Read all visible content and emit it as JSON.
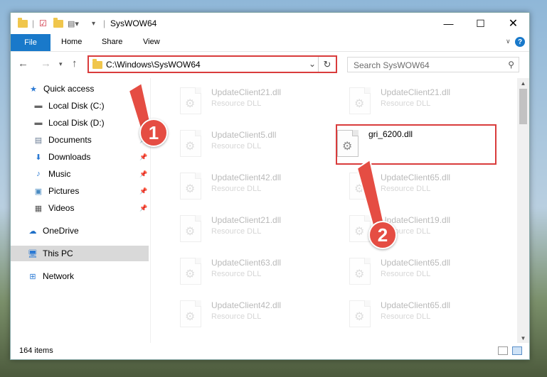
{
  "window": {
    "title": "SysWOW64"
  },
  "ribbon": {
    "tabs": [
      "File",
      "Home",
      "Share",
      "View"
    ],
    "help": "?"
  },
  "address": {
    "path": "C:\\Windows\\SysWOW64",
    "search_placeholder": "Search SysWOW64"
  },
  "sidebar": {
    "items": [
      {
        "label": "Quick access",
        "icon": "star-icon"
      },
      {
        "label": "Local Disk (C:)",
        "icon": "drive-icon",
        "pinned": true
      },
      {
        "label": "Local Disk (D:)",
        "icon": "drive-icon",
        "pinned": true
      },
      {
        "label": "Documents",
        "icon": "documents-icon",
        "pinned": true
      },
      {
        "label": "Downloads",
        "icon": "download-icon",
        "pinned": true
      },
      {
        "label": "Music",
        "icon": "music-icon",
        "pinned": true
      },
      {
        "label": "Pictures",
        "icon": "pictures-icon",
        "pinned": true
      },
      {
        "label": "Videos",
        "icon": "videos-icon",
        "pinned": true
      },
      {
        "label": "OneDrive",
        "icon": "cloud-icon"
      },
      {
        "label": "This PC",
        "icon": "computer-icon",
        "selected": true
      },
      {
        "label": "Network",
        "icon": "network-icon"
      }
    ]
  },
  "files": {
    "left": [
      {
        "name": "UpdateClient21.dll",
        "type": "Resource DLL"
      },
      {
        "name": "UpdateClient5.dll",
        "type": "Resource DLL"
      },
      {
        "name": "UpdateClient42.dll",
        "type": "Resource DLL"
      },
      {
        "name": "UpdateClient21.dll",
        "type": "Resource DLL"
      },
      {
        "name": "UpdateClient63.dll",
        "type": "Resource DLL"
      },
      {
        "name": "UpdateClient42.dll",
        "type": "Resource DLL"
      }
    ],
    "right": [
      {
        "name": "UpdateClient21.dll",
        "type": "Resource DLL"
      },
      {
        "name": "gri_6200.dll",
        "type": ""
      },
      {
        "name": "UpdateClient65.dll",
        "type": "Resource DLL"
      },
      {
        "name": "UpdateClient19.dll",
        "type": "Resource DLL"
      },
      {
        "name": "UpdateClient65.dll",
        "type": "Resource DLL"
      },
      {
        "name": "UpdateClient65.dll",
        "type": "Resource DLL"
      }
    ]
  },
  "status": {
    "item_count": "164 items"
  },
  "callouts": [
    "1",
    "2"
  ],
  "colors": {
    "accent": "#1979ca",
    "highlight": "#d93c3c"
  }
}
